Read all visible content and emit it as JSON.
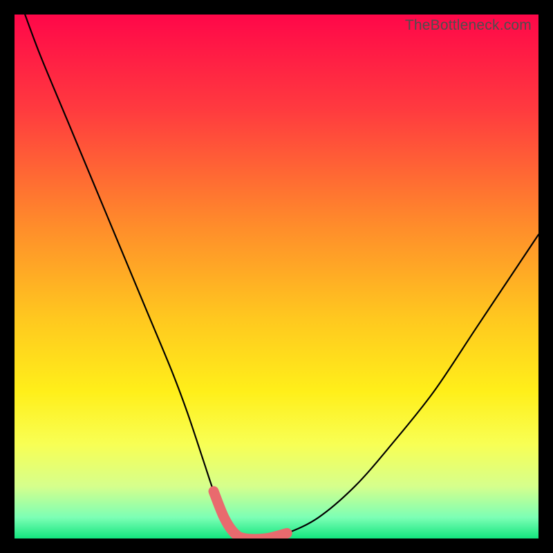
{
  "watermark": "TheBottleneck.com",
  "chart_data": {
    "type": "line",
    "title": "",
    "xlabel": "",
    "ylabel": "",
    "ylim": [
      0,
      100
    ],
    "xlim": [
      0,
      100
    ],
    "series": [
      {
        "name": "bottleneck-curve",
        "x": [
          2,
          5,
          10,
          15,
          20,
          25,
          30,
          33,
          36,
          38,
          40,
          42,
          44,
          48,
          52,
          58,
          65,
          72,
          80,
          88,
          96,
          100
        ],
        "values": [
          100,
          92,
          80,
          68,
          56,
          44,
          32,
          24,
          15,
          9,
          4,
          1,
          0,
          0,
          1,
          4,
          10,
          18,
          28,
          40,
          52,
          58
        ]
      }
    ],
    "highlight": {
      "x": [
        38,
        40,
        42,
        44,
        48,
        52
      ],
      "values": [
        9,
        4,
        1,
        0,
        0,
        1
      ]
    },
    "gradient_stops": [
      {
        "offset": 0,
        "color": "#ff0749"
      },
      {
        "offset": 18,
        "color": "#ff3a3f"
      },
      {
        "offset": 40,
        "color": "#ff8b2b"
      },
      {
        "offset": 58,
        "color": "#ffc81f"
      },
      {
        "offset": 72,
        "color": "#ffef1a"
      },
      {
        "offset": 82,
        "color": "#f8ff54"
      },
      {
        "offset": 90,
        "color": "#d6ff8c"
      },
      {
        "offset": 96,
        "color": "#7cffb5"
      },
      {
        "offset": 100,
        "color": "#13e57e"
      }
    ]
  }
}
